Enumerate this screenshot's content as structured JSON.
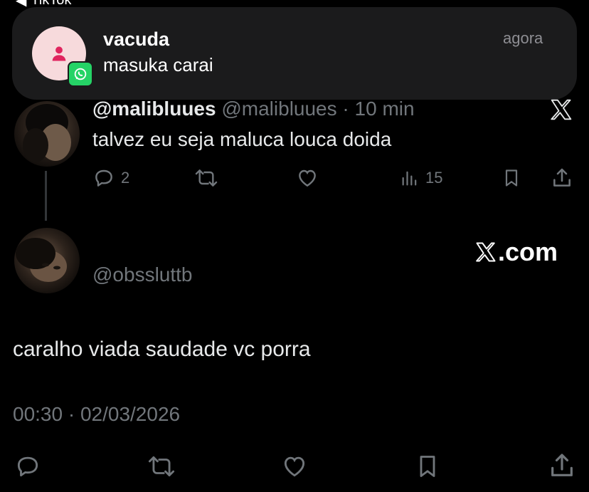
{
  "status_bar": {
    "back_label": "TikTok"
  },
  "notification": {
    "app_icon": "whatsapp-icon",
    "avatar_icon": "person-icon",
    "title": "vacuda",
    "message": "masuka carai",
    "time": "agora",
    "colors": {
      "banner": "#1b1b1c",
      "avatar_bg": "#f7dadc",
      "badge": "#25d366"
    }
  },
  "quoted_tweet": {
    "display_name": "@malibluues",
    "handle": "@malibluues",
    "separator": "·",
    "time": "10 min",
    "text": "talvez eu seja maluca louca doida",
    "replies": "2",
    "views": "15"
  },
  "main_tweet": {
    "handle": "@obssluttb",
    "site_label": ".com",
    "text": "caralho viada saudade vc porra",
    "timestamp": "00:30 · 02/03/2026"
  },
  "colors": {
    "background": "#000000",
    "text": "#e7e9ea",
    "muted": "#71767b"
  }
}
